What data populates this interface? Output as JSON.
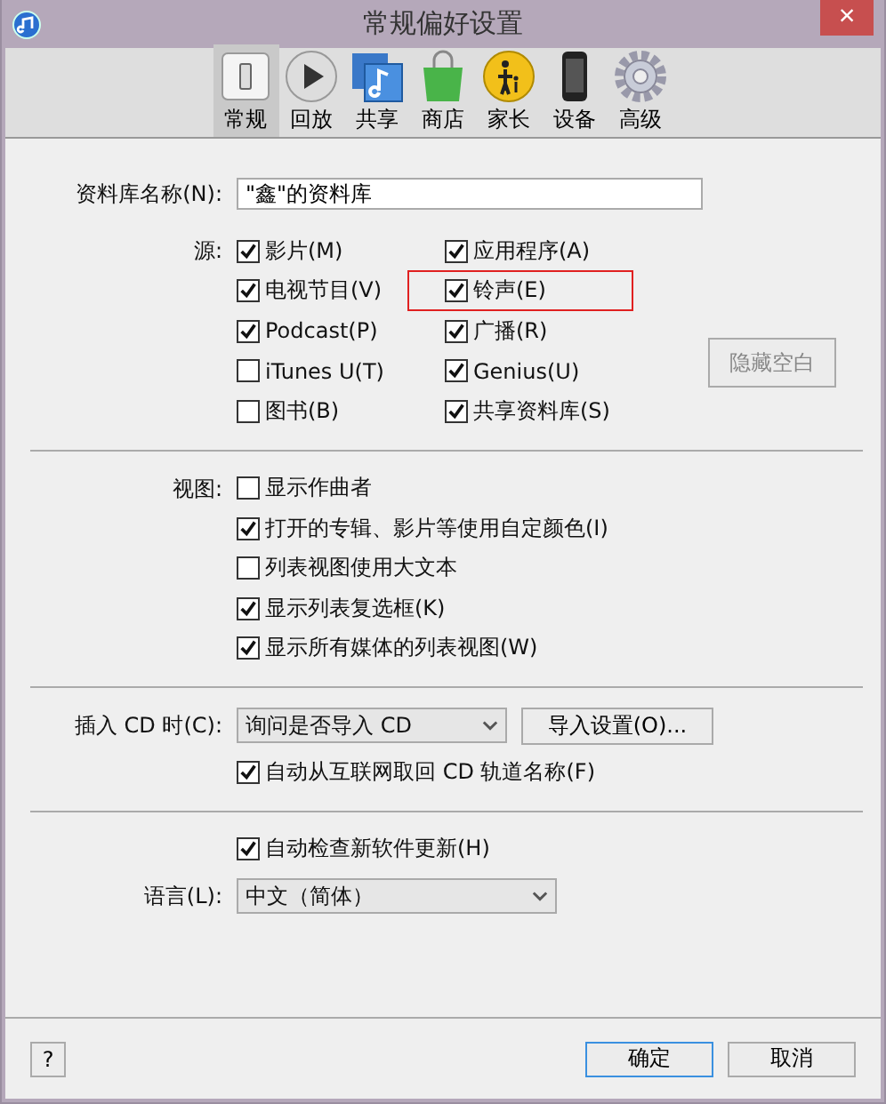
{
  "window": {
    "title": "常规偏好设置",
    "close": "×"
  },
  "tabs": [
    {
      "label": "常规",
      "selected": true
    },
    {
      "label": "回放",
      "selected": false
    },
    {
      "label": "共享",
      "selected": false
    },
    {
      "label": "商店",
      "selected": false
    },
    {
      "label": "家长",
      "selected": false
    },
    {
      "label": "设备",
      "selected": false
    },
    {
      "label": "高级",
      "selected": false
    }
  ],
  "library_name": {
    "label": "资料库名称(N):",
    "value": "\"鑫\"的资料库"
  },
  "sources": {
    "label": "源:",
    "items": [
      {
        "label": "影片(M)",
        "checked": true,
        "highlighted": false
      },
      {
        "label": "应用程序(A)",
        "checked": true,
        "highlighted": false
      },
      {
        "label": "电视节目(V)",
        "checked": true,
        "highlighted": false
      },
      {
        "label": "铃声(E)",
        "checked": true,
        "highlighted": true
      },
      {
        "label": "Podcast(P)",
        "checked": true,
        "highlighted": false
      },
      {
        "label": "广播(R)",
        "checked": true,
        "highlighted": false
      },
      {
        "label": "iTunes U(T)",
        "checked": false,
        "highlighted": false
      },
      {
        "label": "Genius(U)",
        "checked": true,
        "highlighted": false
      },
      {
        "label": "图书(B)",
        "checked": false,
        "highlighted": false
      },
      {
        "label": "共享资料库(S)",
        "checked": true,
        "highlighted": false
      }
    ],
    "hide_button": {
      "label": "隐藏空白",
      "disabled": true
    }
  },
  "views": {
    "label": "视图:",
    "items": [
      {
        "label": "显示作曲者",
        "checked": false
      },
      {
        "label": "打开的专辑、影片等使用自定颜色(I)",
        "checked": true
      },
      {
        "label": "列表视图使用大文本",
        "checked": false
      },
      {
        "label": "显示列表复选框(K)",
        "checked": true
      },
      {
        "label": "显示所有媒体的列表视图(W)",
        "checked": true
      }
    ]
  },
  "cd": {
    "label": "插入 CD 时(C):",
    "value": "询问是否导入 CD",
    "button": "导入设置(O)...",
    "auto_fetch": {
      "label": "自动从互联网取回 CD 轨道名称(F)",
      "checked": true
    }
  },
  "updates": {
    "label": "自动检查新软件更新(H)",
    "checked": true
  },
  "language": {
    "label": "语言(L):",
    "value": "中文（简体）"
  },
  "footer": {
    "help": "?",
    "ok": "确定",
    "cancel": "取消"
  }
}
